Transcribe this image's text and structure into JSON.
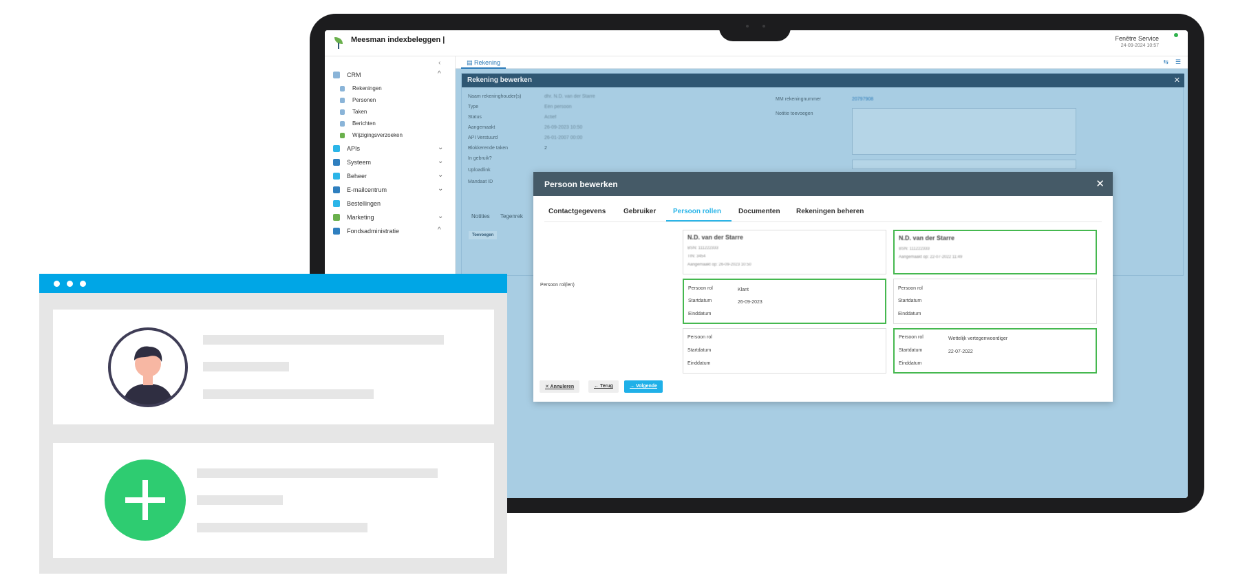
{
  "app": {
    "title": "Meesman indexbeleggen |",
    "user_name": "Fenêtre Service",
    "user_datetime": "24-09-2024 10:57",
    "collapse_icon": "‹"
  },
  "sidebar": {
    "items": [
      {
        "label": "CRM",
        "chevron": "^",
        "icon": "id-card-icon"
      },
      {
        "label": "APIs",
        "chevron": "⌄",
        "icon": "funnel-icon"
      },
      {
        "label": "Systeem",
        "chevron": "⌄",
        "icon": "server-icon"
      },
      {
        "label": "Beheer",
        "chevron": "⌄",
        "icon": "tools-icon"
      },
      {
        "label": "E-mailcentrum",
        "chevron": "⌄",
        "icon": "mail-icon"
      },
      {
        "label": "Bestellingen",
        "chevron": "",
        "icon": "cart-icon"
      },
      {
        "label": "Marketing",
        "chevron": "⌄",
        "icon": "megaphone-icon"
      },
      {
        "label": "Fondsadministratie",
        "chevron": "^",
        "icon": "ledger-icon"
      }
    ],
    "crm_sub": [
      {
        "label": "Rekeningen",
        "icon": "document-icon"
      },
      {
        "label": "Personen",
        "icon": "people-icon"
      },
      {
        "label": "Taken",
        "icon": "list-icon"
      },
      {
        "label": "Berichten",
        "icon": "chat-icon"
      },
      {
        "label": "Wijzigingsverzoeken",
        "icon": "pin-icon"
      }
    ]
  },
  "tabs": {
    "active_label": "Rekening"
  },
  "rekening": {
    "title": "Rekening bewerken",
    "fields": [
      {
        "label": "Naam rekeninghouder(s)",
        "value": "dhr. N.D. van der Starre"
      },
      {
        "label": "Type",
        "value": "Eén persoon"
      },
      {
        "label": "Status",
        "value": "Actief"
      },
      {
        "label": "Aangemaakt",
        "value": "26-09-2023 10:50"
      },
      {
        "label": "API Verstuurd",
        "value": "26-01-2007 00:00"
      },
      {
        "label": "Blokkerende taken",
        "value": "2"
      },
      {
        "label": "In gebruik?",
        "value": ""
      },
      {
        "label": "Uploadlink",
        "value": ""
      },
      {
        "label": "Mandaat ID",
        "value": ""
      }
    ],
    "mm_label": "MM rekeningnummer",
    "mm_value": "20797908",
    "notitie_label": "Notitie toevoegen",
    "sub_tabs": [
      "Notities",
      "Tegenrek"
    ],
    "toevoegen_label": "Toevoegen"
  },
  "modal": {
    "title": "Persoon bewerken",
    "tabs": [
      "Contactgegevens",
      "Gebruiker",
      "Persoon rollen",
      "Documenten",
      "Rekeningen beheren"
    ],
    "active_tab": "Persoon rollen",
    "persoon_rollen_label": "Persoon rol(len)",
    "cards_left": {
      "name": "N.D. van der Starre",
      "bsn": "BSN: 111222333",
      "tin": "TIN: 3454",
      "created": "Aangemaakt op: 26-09-2023 10:50"
    },
    "cards_right": {
      "name": "N.D. van der Starre",
      "bsn": "BSN: 111222333",
      "created": "Aangemaakt op: 22-07-2022 11:49"
    },
    "role_keys": {
      "rol": "Persoon rol",
      "start": "Startdatum",
      "eind": "Einddatum"
    },
    "roles": [
      {
        "rol": "Klant",
        "start": "26-09-2023",
        "eind": ""
      },
      {
        "rol": "",
        "start": "",
        "eind": ""
      },
      {
        "rol": "",
        "start": "",
        "eind": ""
      },
      {
        "rol": "Wettelijk vertegenwoordiger",
        "start": "22-07-2022",
        "eind": ""
      }
    ],
    "buttons": {
      "cancel": "✕ Annuleren",
      "back": "← Terug",
      "next": "→ Volgende"
    }
  },
  "colors": {
    "accent": "#2bb5e8",
    "header_dark": "#455a67",
    "green_border": "#45b84f",
    "browser_bar": "#00a6e6",
    "plus_green": "#2ecc71"
  }
}
